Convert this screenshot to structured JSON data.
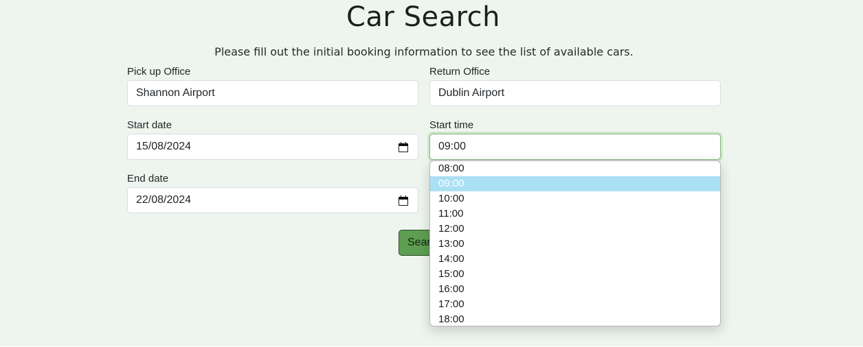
{
  "header": {
    "title": "Car Search",
    "subtitle": "Please fill out the initial booking information to see the list of available cars."
  },
  "form": {
    "pickup_office": {
      "label": "Pick up Office",
      "value": "Shannon Airport"
    },
    "return_office": {
      "label": "Return Office",
      "value": "Dublin Airport"
    },
    "start_date": {
      "label": "Start date",
      "value": "15/08/2024",
      "icon": "calendar-icon"
    },
    "start_time": {
      "label": "Start time",
      "value": "09:00"
    },
    "end_date": {
      "label": "End date",
      "value": "22/08/2024",
      "icon": "calendar-icon"
    },
    "search_button": {
      "label": "Search"
    }
  },
  "time_dropdown": {
    "selected": "09:00",
    "options": [
      "08:00",
      "09:00",
      "10:00",
      "11:00",
      "12:00",
      "13:00",
      "14:00",
      "15:00",
      "16:00",
      "17:00",
      "18:00"
    ]
  },
  "colors": {
    "background": "#eef5ee",
    "button": "#5e9e52",
    "selected_option": "#abdff3",
    "focus_border": "#86b77f"
  }
}
